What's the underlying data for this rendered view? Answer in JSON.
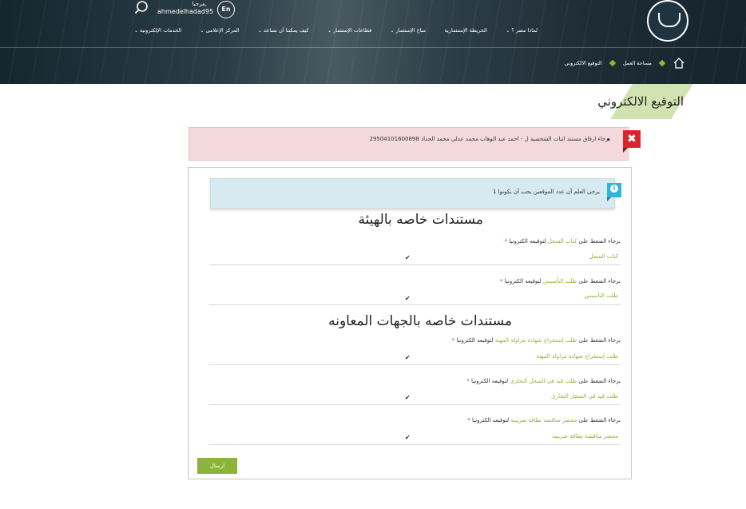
{
  "header": {
    "lang_label": "En",
    "greeting": "مرحبا,",
    "username": "ahmedelhadad95",
    "nav": [
      {
        "label": "لماذا مصر ؟",
        "has_caret": true
      },
      {
        "label": "الخريطة الإستثمارية",
        "has_caret": false
      },
      {
        "label": "مناخ الإستثمار",
        "has_caret": true
      },
      {
        "label": "قطاعات الإستثمار",
        "has_caret": true
      },
      {
        "label": "كيف يمكننا أن نساعد",
        "has_caret": true
      },
      {
        "label": "المركز الإعلامى",
        "has_caret": true
      },
      {
        "label": "الخدمات الإلكترونية",
        "has_caret": true
      }
    ],
    "caret": "⌄"
  },
  "breadcrumb": {
    "items": [
      "مساحة العمل",
      "التوقيع الالكتروني"
    ]
  },
  "page": {
    "title": "التوقيع الالكتروني"
  },
  "alerts": {
    "error_icon": "x-icon",
    "error_text": "برجاء ارفاق مستند اثبات الشخصية ل - احمد عبد الوهاب محمد عدلي محمد الحداد 29504101600898",
    "info_text": "يرجي العلم أن عدد الموقعين يجب أن يكونوا 1"
  },
  "sections": [
    {
      "title": "مستندات خاصه بالهيئة",
      "docs": [
        {
          "prefix": "برجاء الضغط على",
          "link": "كتاب السجل",
          "suffix": "لتوقيعه الكترونيا",
          "req": "*",
          "value": "كتاب السجل",
          "check": "✔"
        },
        {
          "prefix": "برجاء الضغط على",
          "link": "طلب التأسيس",
          "suffix": "لتوقيعه الكترونيا",
          "req": "*",
          "value": "طلب التأسيس",
          "check": "✔"
        }
      ]
    },
    {
      "title": "مستندات خاصه بالجهات المعاونه",
      "docs": [
        {
          "prefix": "برجاء الضغط على",
          "link": "طلب إستخراج شهادة مزاولة المهنة",
          "suffix": "لتوقيعه الكترونيا",
          "req": "*",
          "value": "طلب إستخراج شهادة مزاولة المهنة",
          "check": "✔"
        },
        {
          "prefix": "برجاء الضغط على",
          "link": "طلب قيد في السجل التجاري",
          "suffix": "لتوقيعه الكترونيا",
          "req": "*",
          "value": "طلب قيد في السجل التجاري",
          "check": "✔"
        },
        {
          "prefix": "برجاء الضغط على",
          "link": "محضر مناقشة بطاقة ضريبية",
          "suffix": "لتوقيعه الكترونيا",
          "req": "*",
          "value": "محضر مناقشة بطاقة ضريبية",
          "check": "✔"
        }
      ]
    }
  ],
  "actions": {
    "submit_label": "ارسال"
  },
  "colors": {
    "accent_green": "#8cb43a",
    "error_red": "#d9262c",
    "info_blue": "#2fb6dc"
  }
}
